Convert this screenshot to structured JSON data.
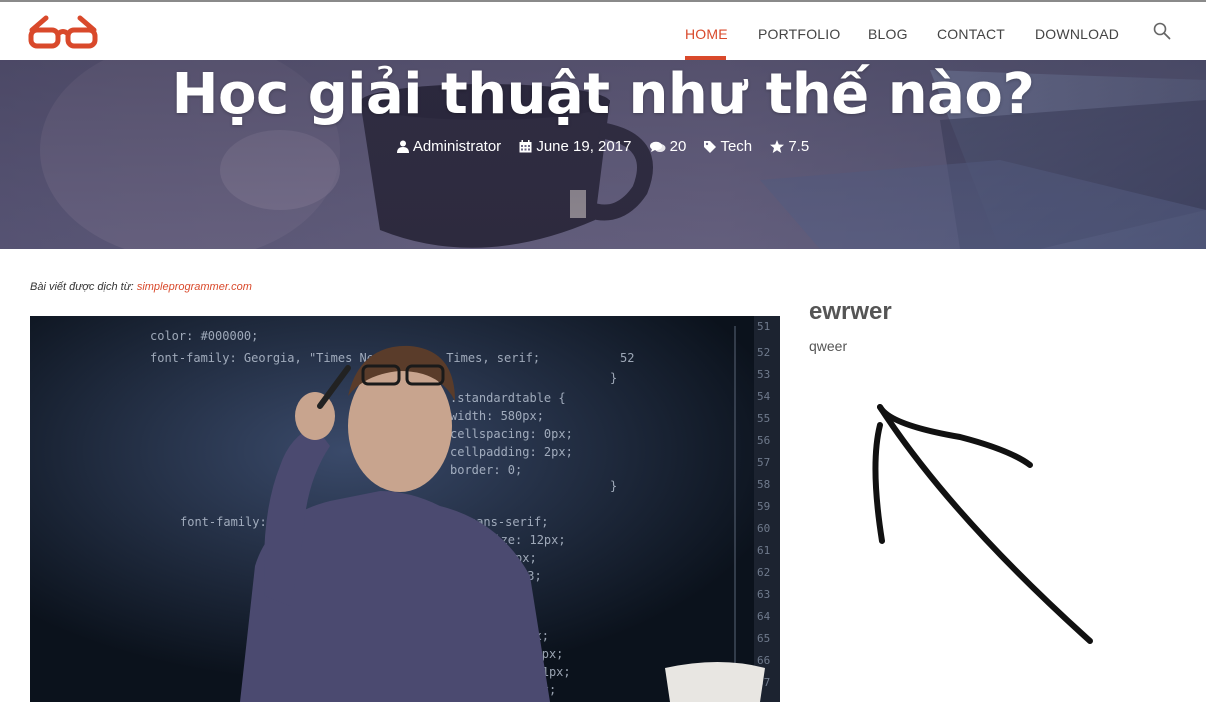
{
  "brand": {
    "accent": "#d9492b"
  },
  "nav": {
    "items": [
      {
        "label": "HOME",
        "active": true
      },
      {
        "label": "PORTFOLIO",
        "active": false
      },
      {
        "label": "BLOG",
        "active": false
      },
      {
        "label": "CONTACT",
        "active": false
      },
      {
        "label": "DOWNLOAD",
        "active": false
      }
    ],
    "search_icon": "search-icon"
  },
  "hero": {
    "title": "Học giải thuật như thế nào?",
    "meta": {
      "author": "Administrator",
      "date": "June 19, 2017",
      "comments": "20",
      "tag": "Tech",
      "rating": "7.5"
    }
  },
  "article": {
    "credit_prefix": "Bài viết được dịch từ:",
    "credit_link": "simpleprogrammer.com"
  },
  "sidebar": {
    "widget_title": "ewrwer",
    "widget_text": "qweer"
  }
}
